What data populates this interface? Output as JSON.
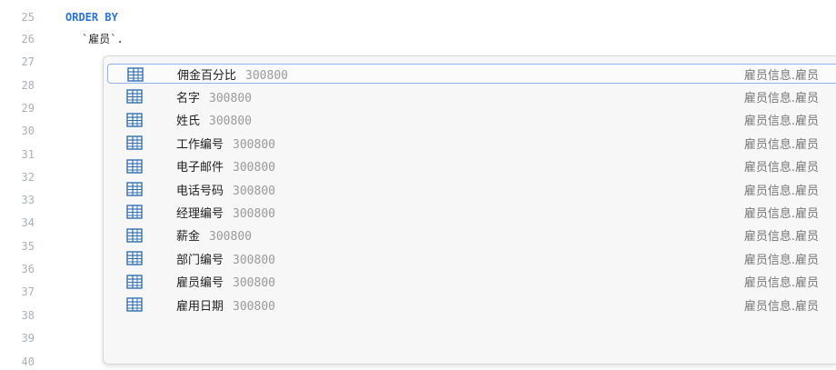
{
  "editor": {
    "line_numbers": [
      "25",
      "26",
      "27",
      "28",
      "29",
      "30",
      "31",
      "32",
      "33",
      "34",
      "35",
      "36",
      "37",
      "38",
      "39",
      "40"
    ],
    "lines": {
      "l25": "ORDER BY",
      "l26": "`雇员`."
    }
  },
  "autocomplete": {
    "items": [
      {
        "name": "佣金百分比",
        "type": "300800",
        "source": "雇员信息.雇员",
        "selected": true
      },
      {
        "name": "名字",
        "type": "300800",
        "source": "雇员信息.雇员"
      },
      {
        "name": "姓氏",
        "type": "300800",
        "source": "雇员信息.雇员"
      },
      {
        "name": "工作编号",
        "type": "300800",
        "source": "雇员信息.雇员"
      },
      {
        "name": "电子邮件",
        "type": "300800",
        "source": "雇员信息.雇员"
      },
      {
        "name": "电话号码",
        "type": "300800",
        "source": "雇员信息.雇员"
      },
      {
        "name": "经理编号",
        "type": "300800",
        "source": "雇员信息.雇员"
      },
      {
        "name": "薪金",
        "type": "300800",
        "source": "雇员信息.雇员"
      },
      {
        "name": "部门编号",
        "type": "300800",
        "source": "雇员信息.雇员"
      },
      {
        "name": "雇员编号",
        "type": "300800",
        "source": "雇员信息.雇员"
      },
      {
        "name": "雇用日期",
        "type": "300800",
        "source": "雇员信息.雇员"
      }
    ],
    "icon": "table-column-icon",
    "colors": {
      "selected_border": "#8fb2ee",
      "icon": "#2f6fb5",
      "keyword": "#2a73d8"
    }
  }
}
